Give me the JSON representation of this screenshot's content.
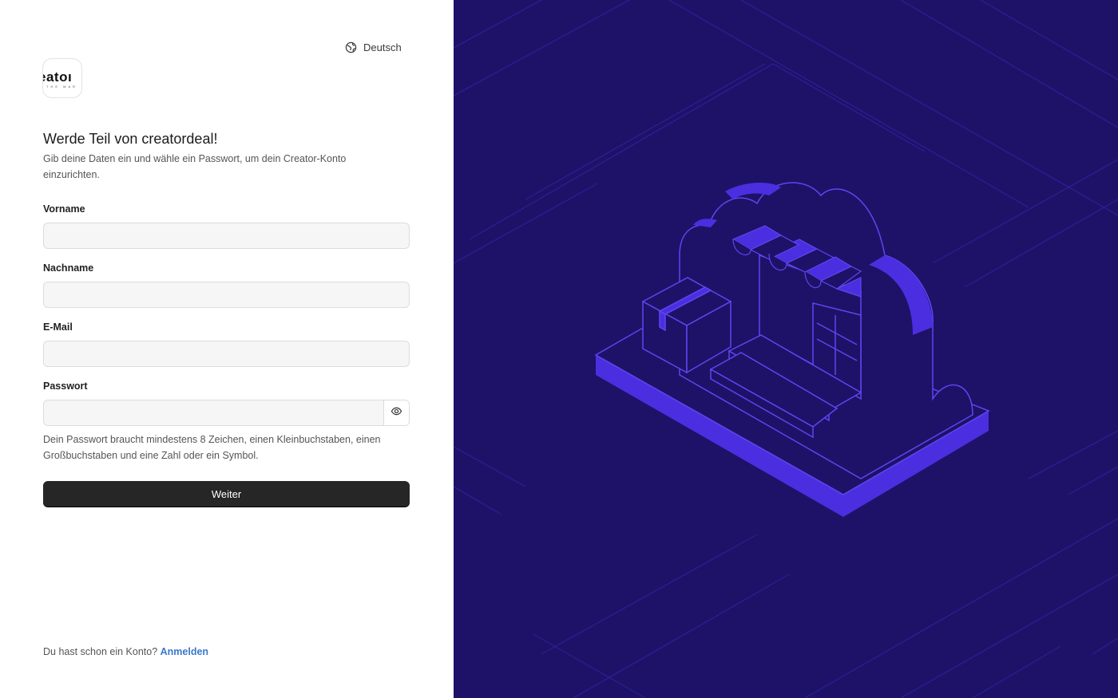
{
  "language": {
    "label": "Deutsch",
    "icon": "globe-icon"
  },
  "logo": {
    "word": "eatoı",
    "sub": "THE MAR"
  },
  "header": {
    "title": "Werde Teil von creatordeal!",
    "subtitle": "Gib deine Daten ein und wähle ein Passwort, um dein Creator-Konto einzurichten."
  },
  "form": {
    "first_name": {
      "label": "Vorname",
      "value": ""
    },
    "last_name": {
      "label": "Nachname",
      "value": ""
    },
    "email": {
      "label": "E-Mail",
      "value": ""
    },
    "password": {
      "label": "Passwort",
      "value": "",
      "toggle_icon": "eye-icon"
    },
    "password_hint": "Dein Passwort braucht mindestens 8 Zeichen, einen Kleinbuchstaben, einen Großbuchstaben und eine Zahl oder ein Symbol.",
    "submit_label": "Weiter"
  },
  "footer": {
    "text": "Du hast schon ein Konto?",
    "link": "Anmelden"
  },
  "colors": {
    "panel_bg": "#1d1268",
    "accent": "#4b2ee0",
    "line": "#5e45f0",
    "button": "#262626",
    "link": "#3a78c9"
  }
}
